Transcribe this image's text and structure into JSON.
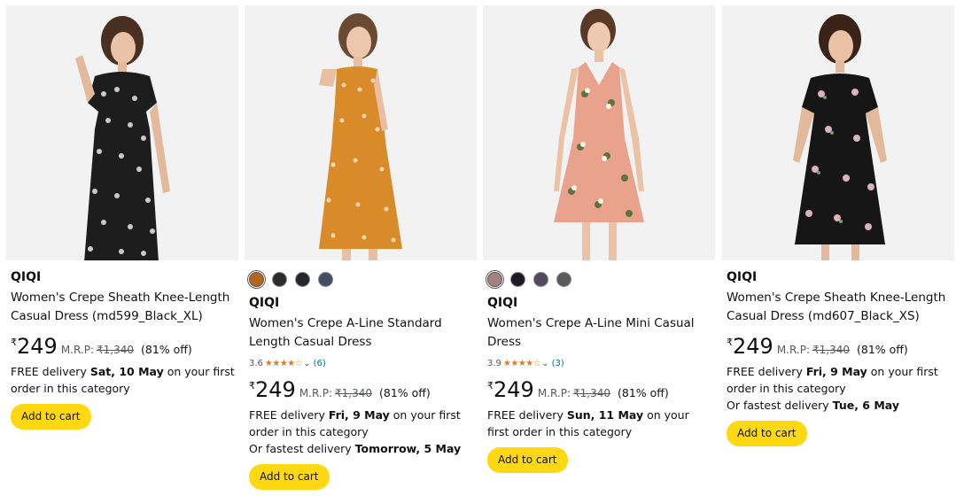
{
  "cards": [
    {
      "image_alt": "Black floral sheath dress",
      "brand": "QIQI",
      "title": "Women's Crepe Sheath Knee-Length Casual Dress (md599_Black_XL)",
      "currency": "₹",
      "price": "249",
      "mrp_label": "M.R.P:",
      "mrp_value": "₹1,340",
      "off": "(81% off)",
      "delivery_prefix": "FREE delivery ",
      "delivery_date": "Sat, 10 May",
      "delivery_suffix": " on your first order in this category",
      "fastest_prefix": "",
      "fastest_date": "",
      "button": "Add to cart"
    },
    {
      "image_alt": "Orange floral A-line dress",
      "brand": "QIQI",
      "swatches": [
        "#b5651d",
        "#2b2b2b",
        "#23272b",
        "#434c66"
      ],
      "title": "Women's Crepe A-Line Standard Length Casual Dress",
      "rating": "3.6",
      "stars": "★★★★☆",
      "rating_count": "(6)",
      "currency": "₹",
      "price": "249",
      "mrp_label": "M.R.P:",
      "mrp_value": "₹1,340",
      "off": "(81% off)",
      "delivery_prefix": "FREE delivery ",
      "delivery_date": "Fri, 9 May",
      "delivery_suffix": " on your first order in this category",
      "fastest_prefix": "Or fastest delivery ",
      "fastest_date": "Tomorrow, 5 May",
      "button": "Add to cart"
    },
    {
      "image_alt": "Peach floral mini dress",
      "brand": "QIQI",
      "swatches": [
        "#a7807c",
        "#1e1a24",
        "#524a5c",
        "#5a5a5a"
      ],
      "title": "Women's Crepe A-Line Mini Casual Dress",
      "rating": "3.9",
      "stars": "★★★★☆",
      "rating_count": "(3)",
      "currency": "₹",
      "price": "249",
      "mrp_label": "M.R.P:",
      "mrp_value": "₹1,340",
      "off": "(81% off)",
      "delivery_prefix": "FREE delivery ",
      "delivery_date": "Sun, 11 May",
      "delivery_suffix": " on your first order in this category",
      "fastest_prefix": "",
      "fastest_date": "",
      "button": "Add to cart"
    },
    {
      "image_alt": "Black rose print sheath dress",
      "brand": "QIQI",
      "title": "Women's Crepe Sheath Knee-Length Casual Dress (md607_Black_XS)",
      "currency": "₹",
      "price": "249",
      "mrp_label": "M.R.P:",
      "mrp_value": "₹1,340",
      "off": "(81% off)",
      "delivery_prefix": "FREE delivery ",
      "delivery_date": "Fri, 9 May",
      "delivery_suffix": " on your first order in this category",
      "fastest_prefix": "Or fastest delivery ",
      "fastest_date": "Tue, 6 May",
      "button": "Add to cart"
    }
  ],
  "colors": {
    "button_bg": "#ffd814",
    "star": "#de7921",
    "link": "#007185",
    "muted": "#565959",
    "image_bg": "#f2f2f2"
  }
}
